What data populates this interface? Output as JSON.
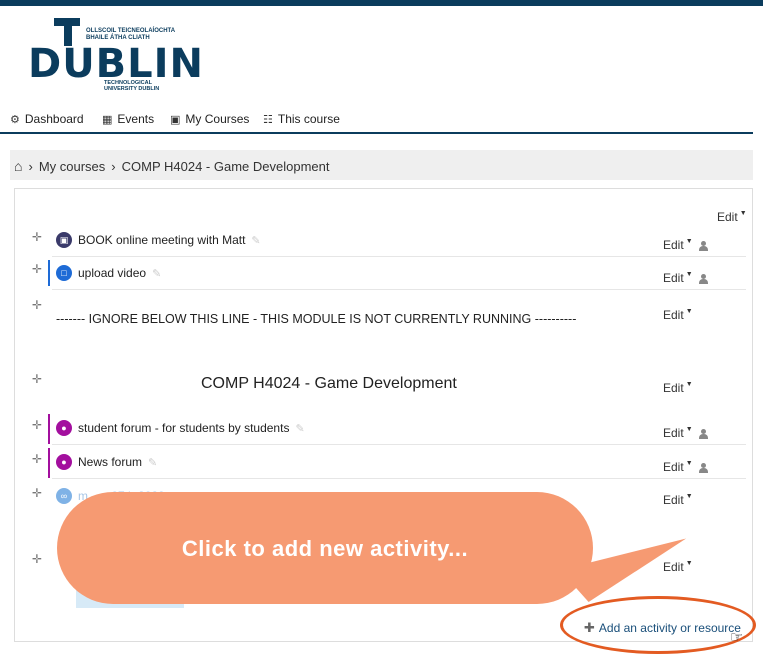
{
  "logo": {
    "letters_top": "T",
    "word": "DUBLIN",
    "small_top": "OLLSCOIL TEICNEOLAÍOCHTA\nBHAILE ÁTHA CLIATH",
    "small_bottom": "TECHNOLOGICAL\nUNIVERSITY DUBLIN"
  },
  "nav": {
    "items": [
      {
        "label": "Dashboard",
        "icon": "dashboard-icon"
      },
      {
        "label": "Events",
        "icon": "calendar-icon"
      },
      {
        "label": "My Courses",
        "icon": "briefcase-icon"
      },
      {
        "label": "This course",
        "icon": "sitemap-icon"
      }
    ]
  },
  "breadcrumb": {
    "items": [
      "My courses",
      "COMP H4024 - Game Development"
    ],
    "separator": "›"
  },
  "course": {
    "edit_label": "Edit",
    "activities": [
      {
        "name": "BOOK online meeting with Matt",
        "icon": "meeting-icon",
        "color": "#3a3a6a"
      },
      {
        "name": "upload video",
        "icon": "assignment-icon",
        "color": "#1e6bd6"
      }
    ],
    "ignore_line": "------- IGNORE BELOW THIS LINE - THIS MODULE IS NOT CURRENTLY RUNNING ----------",
    "section_title": "COMP H4024 - Game Development",
    "section_activities": [
      {
        "name": "student forum - for students by students",
        "icon": "forum-icon",
        "color": "#a30f9e"
      },
      {
        "name": "News forum",
        "icon": "forum-icon",
        "color": "#a30f9e"
      },
      {
        "name": "m...... 07th 2020 ...",
        "icon": "url-icon",
        "color": "#7fb2e6"
      }
    ],
    "add_activity_label": "Add an activity or resource"
  },
  "callout": {
    "text": "Click to add new activity..."
  },
  "colors": {
    "brand": "#0b3c5d",
    "callout": "#f69a72",
    "highlight": "#e35b22"
  }
}
